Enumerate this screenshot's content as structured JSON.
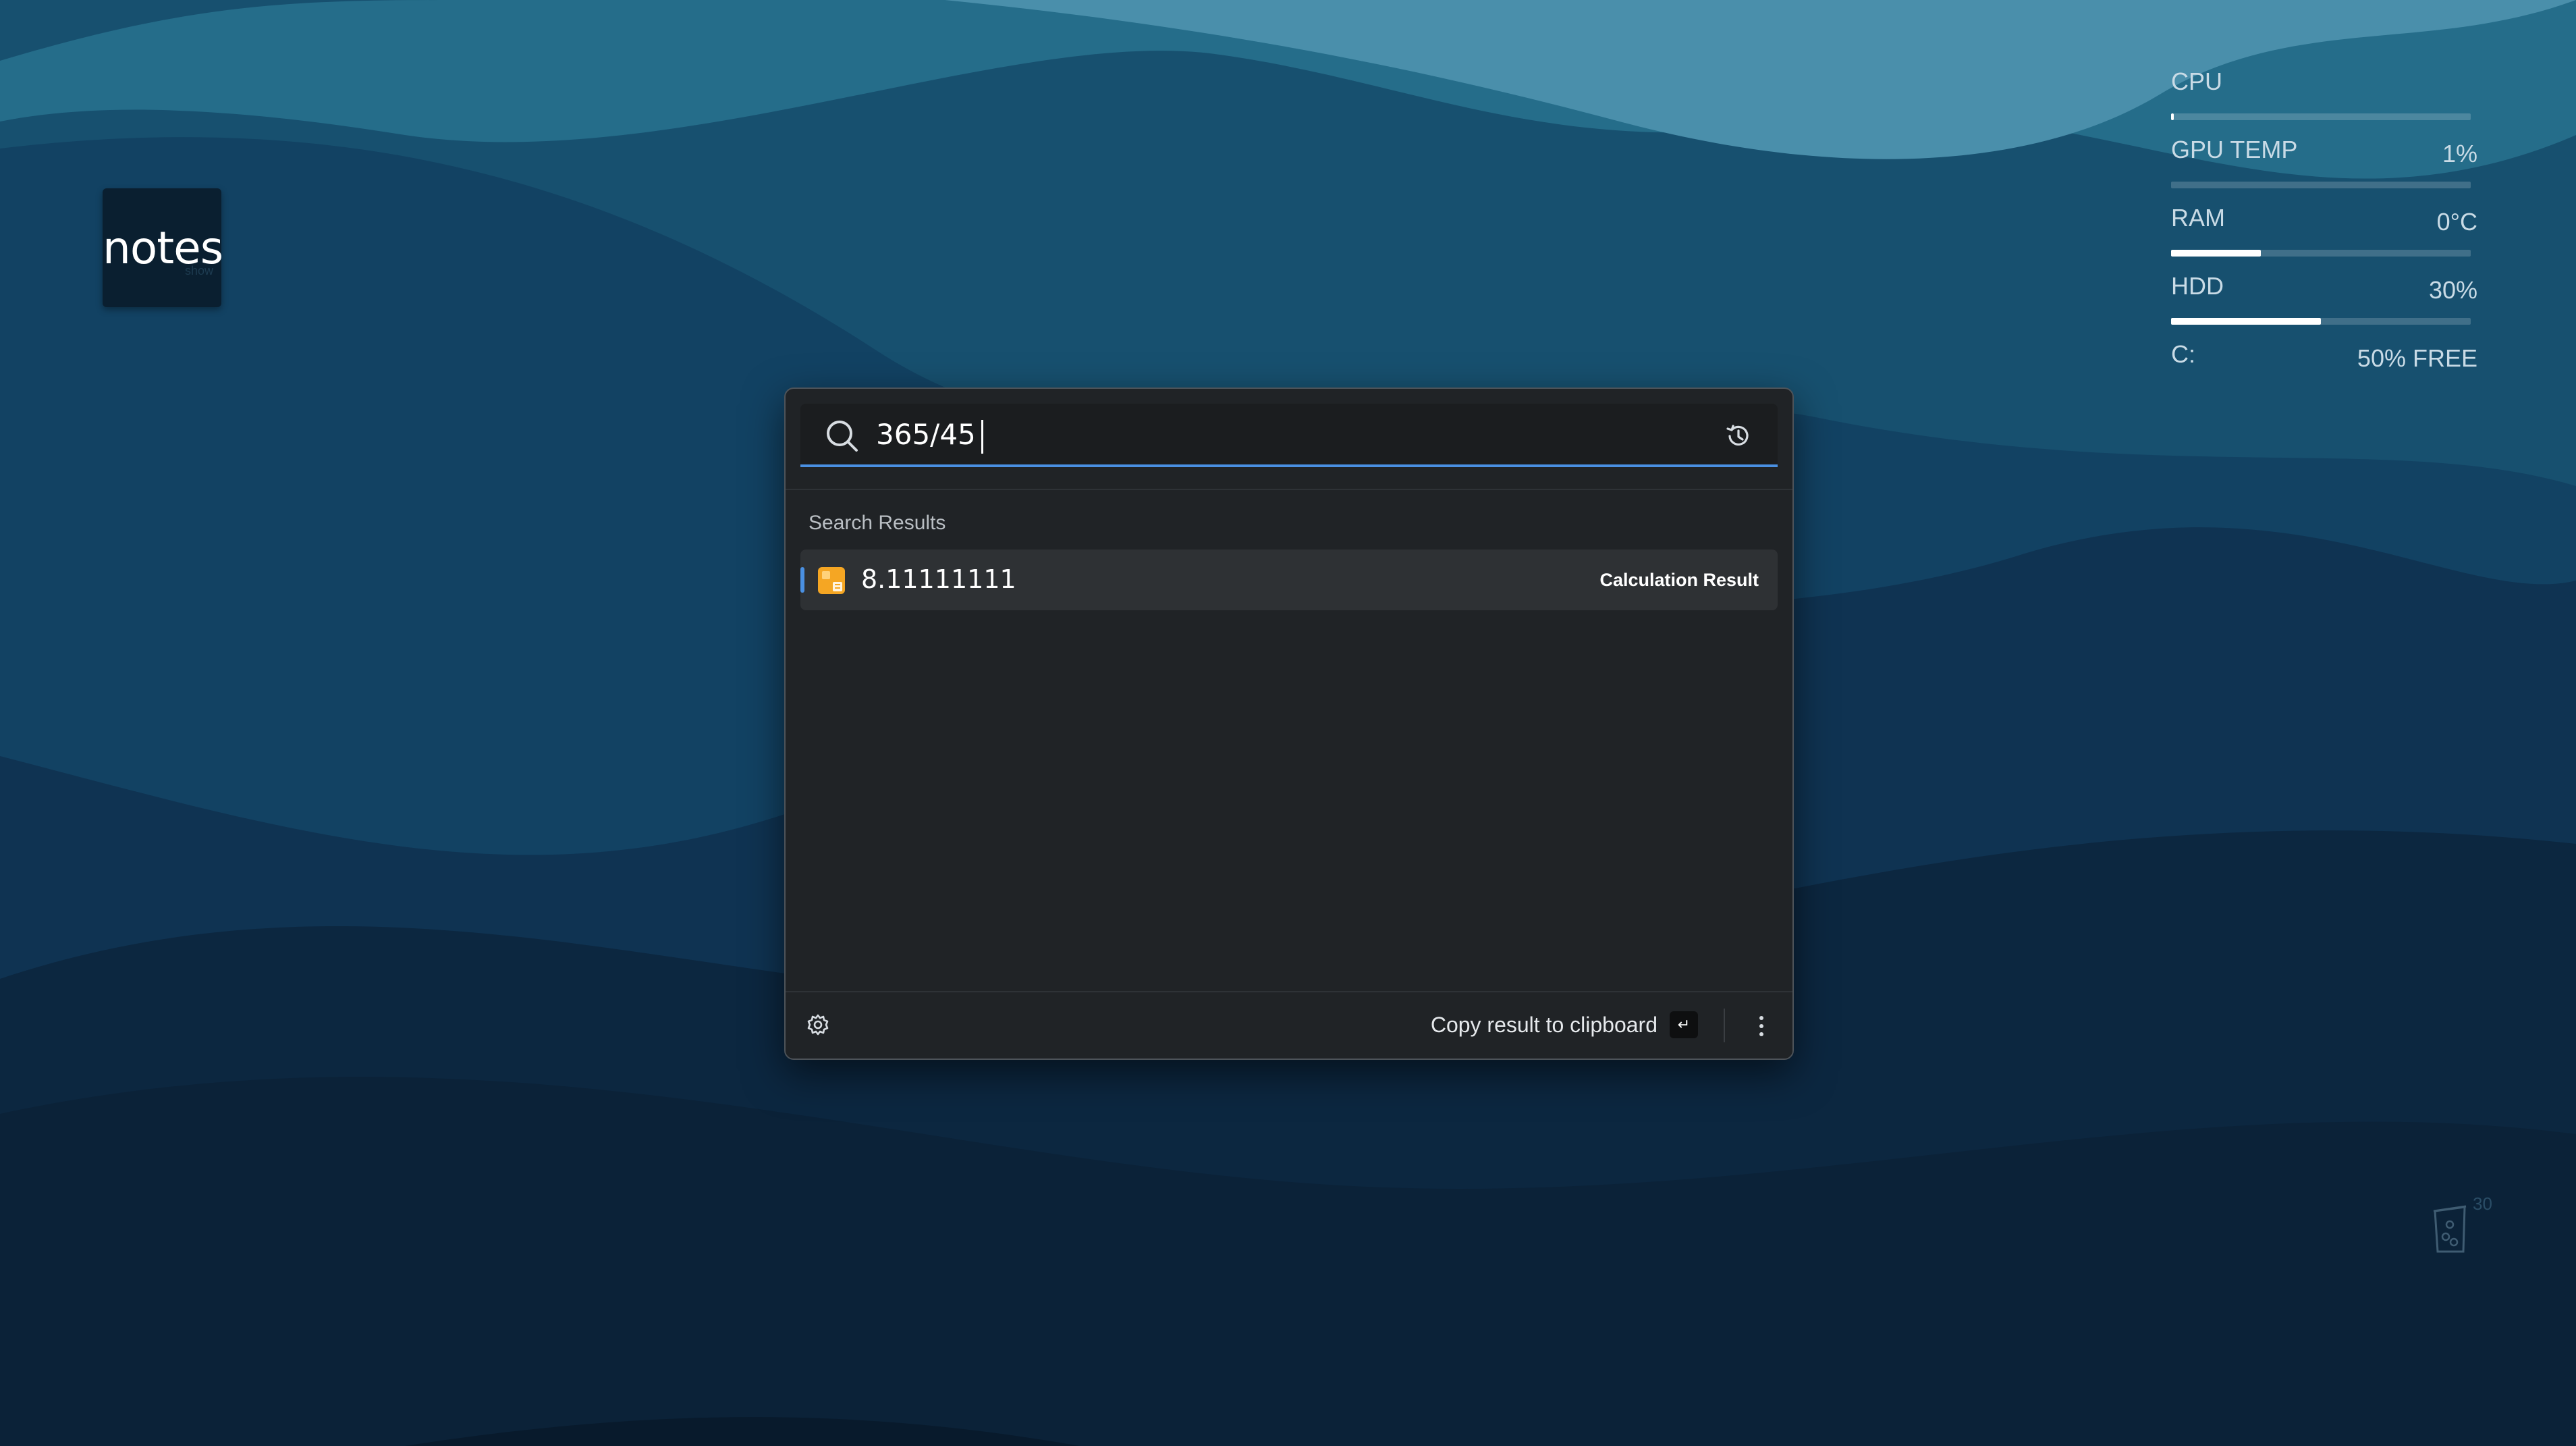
{
  "desktop": {
    "shortcut": {
      "title": "notes",
      "subtitle": "show"
    },
    "system_monitor": {
      "rows": [
        {
          "label": "CPU",
          "value": "",
          "fill": 0.01
        },
        {
          "label": "GPU TEMP",
          "value": "1%",
          "fill": 0.0
        },
        {
          "label": "RAM",
          "value": "0°C",
          "fill": 0.3
        },
        {
          "label": "HDD",
          "value": "30%",
          "fill": 0.5
        }
      ],
      "disk": {
        "label": "C:",
        "value": "50% FREE"
      }
    },
    "recycle_bin": {
      "count": "30"
    }
  },
  "launcher": {
    "search": {
      "query": "365/45"
    },
    "results_heading": "Search Results",
    "results": [
      {
        "value": "8.11111111",
        "tag": "Calculation Result"
      }
    ],
    "footer": {
      "action_label": "Copy result to clipboard",
      "action_key": "↵"
    }
  },
  "colors": {
    "accent": "#4a90e2",
    "panel": "#202326",
    "calc_icon": "#f5a623"
  }
}
